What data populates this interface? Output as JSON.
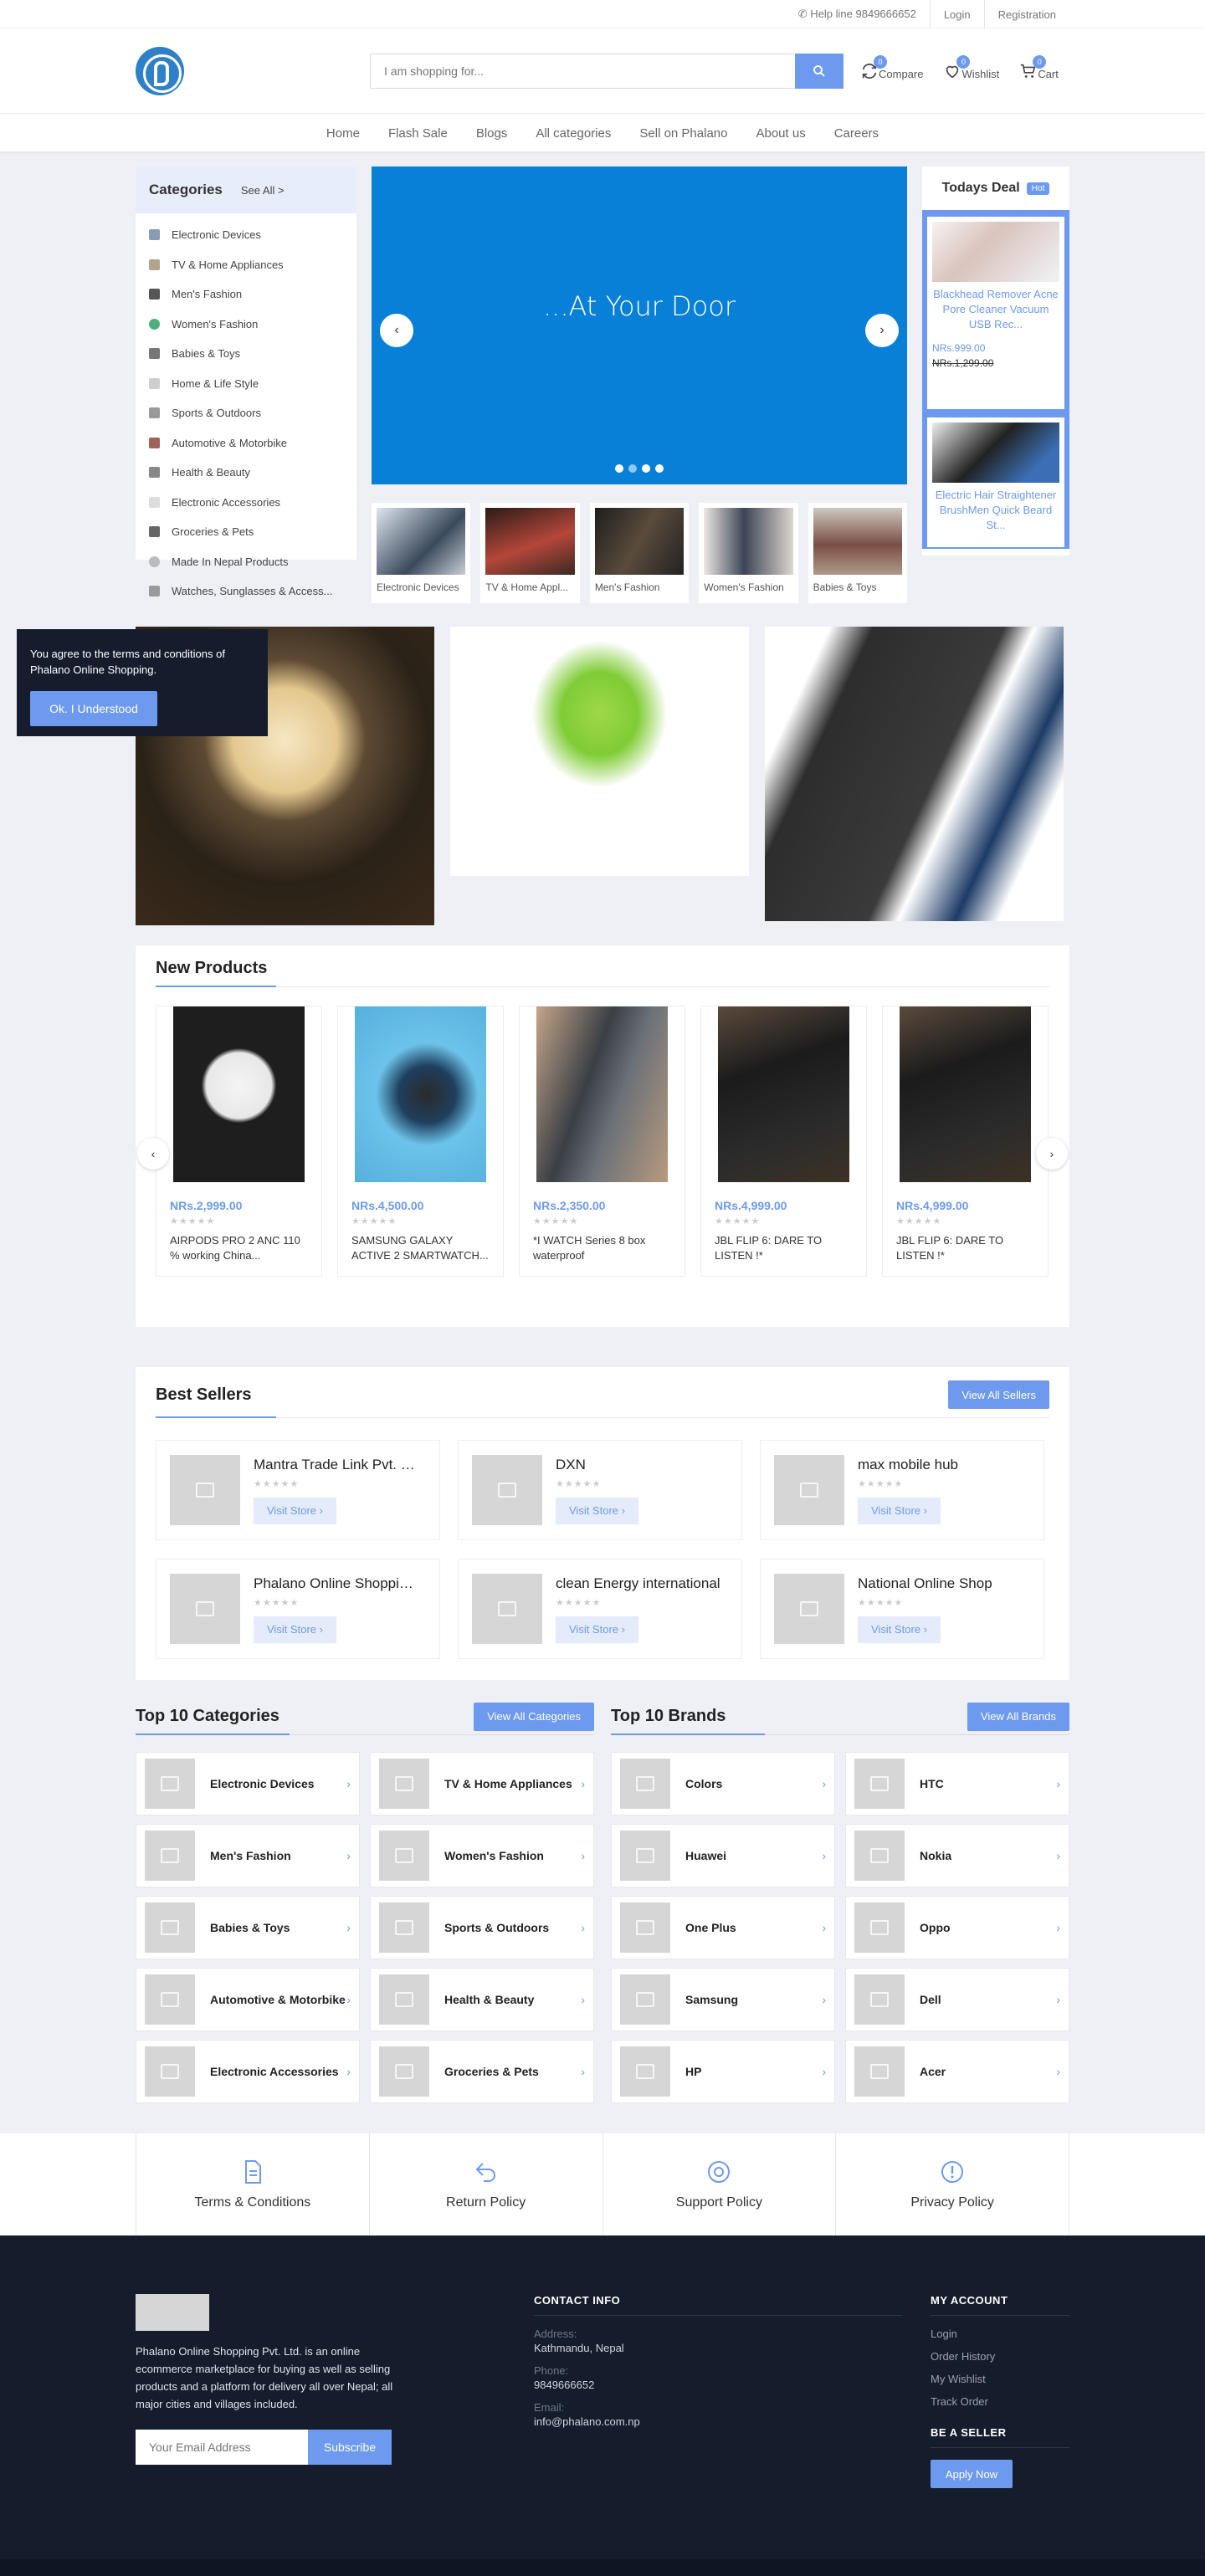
{
  "topbar": {
    "helpline": "✆ Help line 9849666652",
    "login": "Login",
    "registration": "Registration"
  },
  "header": {
    "search_placeholder": "I am shopping for...",
    "compare": {
      "label": "Compare",
      "count": "0"
    },
    "wishlist": {
      "label": "Wishlist",
      "count": "0"
    },
    "cart": {
      "label": "Cart",
      "count": "0"
    }
  },
  "nav": [
    "Home",
    "Flash Sale",
    "Blogs",
    "All categories",
    "Sell on Phalano",
    "About us",
    "Careers"
  ],
  "categories": {
    "title": "Categories",
    "see_all": "See All >",
    "items": [
      "Electronic Devices",
      "TV & Home Appliances",
      "Men's Fashion",
      "Women's Fashion",
      "Babies & Toys",
      "Home & Life Style",
      "Sports & Outdoors",
      "Automotive & Motorbike",
      "Health & Beauty",
      "Electronic Accessories",
      "Groceries & Pets",
      "Made In Nepal Products",
      "Watches, Sunglasses & Access..."
    ]
  },
  "slider": {
    "caption": "...At Your Door",
    "prev": "‹",
    "next": "›"
  },
  "thumbs": [
    "Electronic Devices",
    "TV & Home Appl...",
    "Men's Fashion",
    "Women's Fashion",
    "Babies & Toys"
  ],
  "deal": {
    "title": "Todays Deal",
    "hot": "Hot",
    "items": [
      {
        "name": "Blackhead Remover Acne Pore Cleaner Vacuum USB Rec...",
        "price": "NRs.999.00",
        "old_price": "NRs.1,299.00"
      },
      {
        "name": "Electric Hair Straightener BrushMen Quick Beard St...",
        "price": "",
        "old_price": ""
      }
    ]
  },
  "cookie": {
    "text": "You agree to the terms and conditions of Phalano Online Shopping.",
    "button": "Ok. I Understood"
  },
  "new_products": {
    "title": "New Products",
    "items": [
      {
        "price": "NRs.2,999.00",
        "stars": "★★★★★",
        "name": "AIRPODS PRO 2 ANC 110 % working China..."
      },
      {
        "price": "NRs.4,500.00",
        "stars": "★★★★★",
        "name": "SAMSUNG GALAXY ACTIVE 2 SMARTWATCH..."
      },
      {
        "price": "NRs.2,350.00",
        "stars": "★★★★★",
        "name": "*I WATCH Series 8 box waterproof"
      },
      {
        "price": "NRs.4,999.00",
        "stars": "★★★★★",
        "name": "JBL FLIP 6: DARE TO LISTEN !*"
      },
      {
        "price": "NRs.4,999.00",
        "stars": "★★★★★",
        "name": "JBL FLIP 6: DARE TO LISTEN !*"
      }
    ]
  },
  "best_sellers": {
    "title": "Best Sellers",
    "view_all": "View All Sellers",
    "visit": "Visit Store ›",
    "stars": "★★★★★",
    "items": [
      "Mantra Trade Link Pvt. Ltd.",
      "DXN",
      "max mobile hub",
      "Phalano Online Shopping Pvt. Ltd.",
      "clean Energy international",
      "National Online Shop"
    ]
  },
  "top_categories": {
    "title": "Top 10 Categories",
    "view_all": "View All Categories",
    "items": [
      "Electronic Devices",
      "TV & Home Appliances",
      "Men's Fashion",
      "Women's Fashion",
      "Babies & Toys",
      "Sports & Outdoors",
      "Automotive & Motorbike",
      "Health & Beauty",
      "Electronic Accessories",
      "Groceries & Pets"
    ]
  },
  "top_brands": {
    "title": "Top 10 Brands",
    "view_all": "View All Brands",
    "items": [
      "Colors",
      "HTC",
      "Huawei",
      "Nokia",
      "One Plus",
      "Oppo",
      "Samsung",
      "Dell",
      "HP",
      "Acer"
    ]
  },
  "policies": [
    "Terms & Conditions",
    "Return Policy",
    "Support Policy",
    "Privacy Policy"
  ],
  "footer": {
    "description": "Phalano Online Shopping Pvt. Ltd. is an online ecommerce marketplace for buying as well as selling products and a platform for delivery all over Nepal; all major cities and villages included.",
    "email_placeholder": "Your Email Address",
    "subscribe": "Subscribe",
    "contact_title": "CONTACT INFO",
    "address_label": "Address:",
    "address": "Kathmandu, Nepal",
    "phone_label": "Phone:",
    "phone": "9849666652",
    "email_label": "Email:",
    "email": "info@phalano.com.np",
    "account_title": "MY ACCOUNT",
    "account_links": [
      "Login",
      "Order History",
      "My Wishlist",
      "Track Order"
    ],
    "seller_title": "BE A SELLER",
    "apply": "Apply Now"
  },
  "colors": {
    "accent": "#6d9aef",
    "slider_bg": "#0880d8",
    "footer_bg": "#151d2d"
  }
}
